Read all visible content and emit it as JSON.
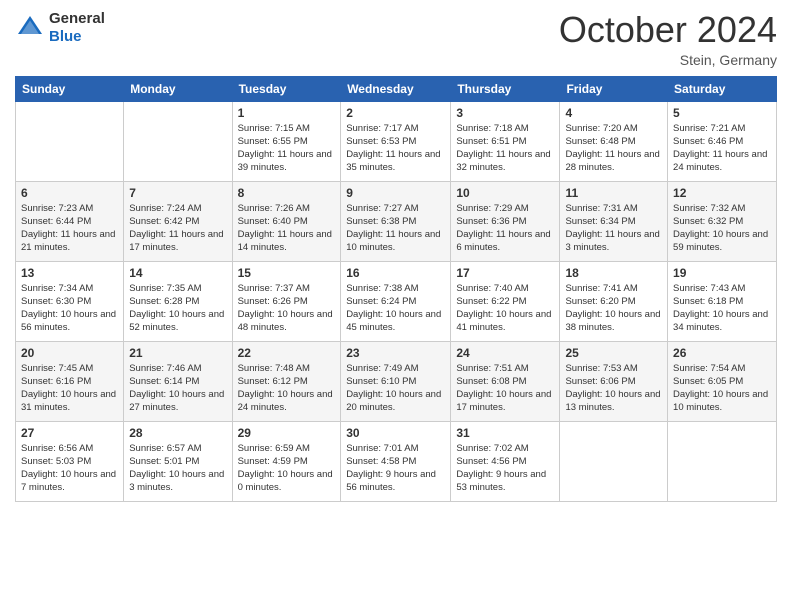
{
  "header": {
    "logo_general": "General",
    "logo_blue": "Blue",
    "month_title": "October 2024",
    "location": "Stein, Germany"
  },
  "weekdays": [
    "Sunday",
    "Monday",
    "Tuesday",
    "Wednesday",
    "Thursday",
    "Friday",
    "Saturday"
  ],
  "weeks": [
    [
      {
        "day": "",
        "info": ""
      },
      {
        "day": "",
        "info": ""
      },
      {
        "day": "1",
        "info": "Sunrise: 7:15 AM\nSunset: 6:55 PM\nDaylight: 11 hours and 39 minutes."
      },
      {
        "day": "2",
        "info": "Sunrise: 7:17 AM\nSunset: 6:53 PM\nDaylight: 11 hours and 35 minutes."
      },
      {
        "day": "3",
        "info": "Sunrise: 7:18 AM\nSunset: 6:51 PM\nDaylight: 11 hours and 32 minutes."
      },
      {
        "day": "4",
        "info": "Sunrise: 7:20 AM\nSunset: 6:48 PM\nDaylight: 11 hours and 28 minutes."
      },
      {
        "day": "5",
        "info": "Sunrise: 7:21 AM\nSunset: 6:46 PM\nDaylight: 11 hours and 24 minutes."
      }
    ],
    [
      {
        "day": "6",
        "info": "Sunrise: 7:23 AM\nSunset: 6:44 PM\nDaylight: 11 hours and 21 minutes."
      },
      {
        "day": "7",
        "info": "Sunrise: 7:24 AM\nSunset: 6:42 PM\nDaylight: 11 hours and 17 minutes."
      },
      {
        "day": "8",
        "info": "Sunrise: 7:26 AM\nSunset: 6:40 PM\nDaylight: 11 hours and 14 minutes."
      },
      {
        "day": "9",
        "info": "Sunrise: 7:27 AM\nSunset: 6:38 PM\nDaylight: 11 hours and 10 minutes."
      },
      {
        "day": "10",
        "info": "Sunrise: 7:29 AM\nSunset: 6:36 PM\nDaylight: 11 hours and 6 minutes."
      },
      {
        "day": "11",
        "info": "Sunrise: 7:31 AM\nSunset: 6:34 PM\nDaylight: 11 hours and 3 minutes."
      },
      {
        "day": "12",
        "info": "Sunrise: 7:32 AM\nSunset: 6:32 PM\nDaylight: 10 hours and 59 minutes."
      }
    ],
    [
      {
        "day": "13",
        "info": "Sunrise: 7:34 AM\nSunset: 6:30 PM\nDaylight: 10 hours and 56 minutes."
      },
      {
        "day": "14",
        "info": "Sunrise: 7:35 AM\nSunset: 6:28 PM\nDaylight: 10 hours and 52 minutes."
      },
      {
        "day": "15",
        "info": "Sunrise: 7:37 AM\nSunset: 6:26 PM\nDaylight: 10 hours and 48 minutes."
      },
      {
        "day": "16",
        "info": "Sunrise: 7:38 AM\nSunset: 6:24 PM\nDaylight: 10 hours and 45 minutes."
      },
      {
        "day": "17",
        "info": "Sunrise: 7:40 AM\nSunset: 6:22 PM\nDaylight: 10 hours and 41 minutes."
      },
      {
        "day": "18",
        "info": "Sunrise: 7:41 AM\nSunset: 6:20 PM\nDaylight: 10 hours and 38 minutes."
      },
      {
        "day": "19",
        "info": "Sunrise: 7:43 AM\nSunset: 6:18 PM\nDaylight: 10 hours and 34 minutes."
      }
    ],
    [
      {
        "day": "20",
        "info": "Sunrise: 7:45 AM\nSunset: 6:16 PM\nDaylight: 10 hours and 31 minutes."
      },
      {
        "day": "21",
        "info": "Sunrise: 7:46 AM\nSunset: 6:14 PM\nDaylight: 10 hours and 27 minutes."
      },
      {
        "day": "22",
        "info": "Sunrise: 7:48 AM\nSunset: 6:12 PM\nDaylight: 10 hours and 24 minutes."
      },
      {
        "day": "23",
        "info": "Sunrise: 7:49 AM\nSunset: 6:10 PM\nDaylight: 10 hours and 20 minutes."
      },
      {
        "day": "24",
        "info": "Sunrise: 7:51 AM\nSunset: 6:08 PM\nDaylight: 10 hours and 17 minutes."
      },
      {
        "day": "25",
        "info": "Sunrise: 7:53 AM\nSunset: 6:06 PM\nDaylight: 10 hours and 13 minutes."
      },
      {
        "day": "26",
        "info": "Sunrise: 7:54 AM\nSunset: 6:05 PM\nDaylight: 10 hours and 10 minutes."
      }
    ],
    [
      {
        "day": "27",
        "info": "Sunrise: 6:56 AM\nSunset: 5:03 PM\nDaylight: 10 hours and 7 minutes."
      },
      {
        "day": "28",
        "info": "Sunrise: 6:57 AM\nSunset: 5:01 PM\nDaylight: 10 hours and 3 minutes."
      },
      {
        "day": "29",
        "info": "Sunrise: 6:59 AM\nSunset: 4:59 PM\nDaylight: 10 hours and 0 minutes."
      },
      {
        "day": "30",
        "info": "Sunrise: 7:01 AM\nSunset: 4:58 PM\nDaylight: 9 hours and 56 minutes."
      },
      {
        "day": "31",
        "info": "Sunrise: 7:02 AM\nSunset: 4:56 PM\nDaylight: 9 hours and 53 minutes."
      },
      {
        "day": "",
        "info": ""
      },
      {
        "day": "",
        "info": ""
      }
    ]
  ]
}
